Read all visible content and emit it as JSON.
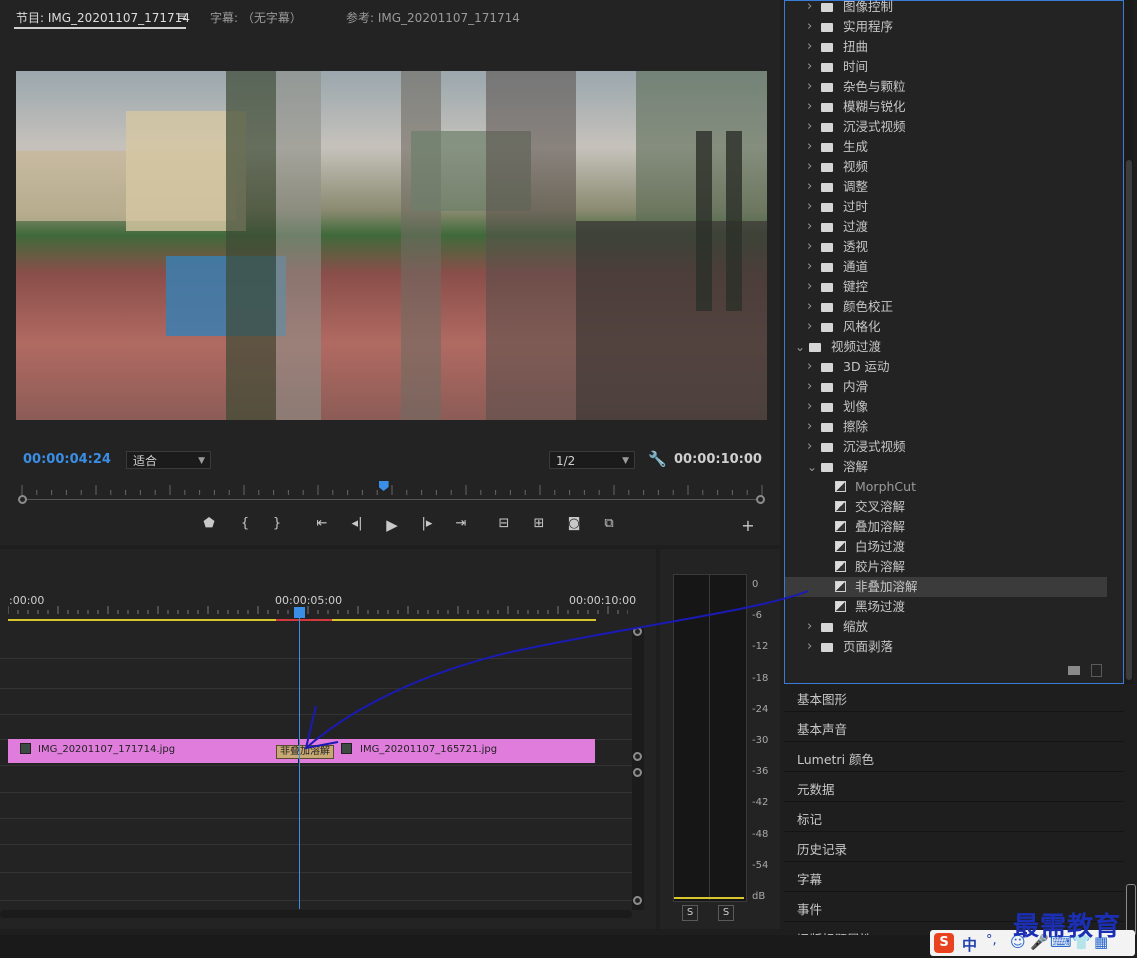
{
  "monitor": {
    "tabs": [
      "节目: IMG_20201107_171714",
      "字幕: （无字幕）",
      "参考: IMG_20201107_171714"
    ],
    "menu_glyph": "≡",
    "current_time": "00:00:04:24",
    "duration": "00:00:10:00",
    "fit_value": "适合",
    "resolution_value": "1/2",
    "playhead_fraction": 0.49
  },
  "timeline": {
    "ticks": [
      ":00:00",
      "00:00:05:00",
      "00:00:10:00"
    ],
    "clips": [
      "IMG_20201107_171714.jpg",
      "IMG_20201107_165721.jpg"
    ],
    "transition_label": "非叠加溶解"
  },
  "meter": {
    "scale": [
      "0",
      "-6",
      "-12",
      "-18",
      "-24",
      "-30",
      "-36",
      "-42",
      "-48",
      "-54",
      "dB"
    ],
    "solo_labels": [
      "S",
      "S"
    ]
  },
  "effects": {
    "rows": [
      {
        "label": "图像控制",
        "level": 1,
        "kind": "folder",
        "open": false
      },
      {
        "label": "实用程序",
        "level": 1,
        "kind": "folder",
        "open": false
      },
      {
        "label": "扭曲",
        "level": 1,
        "kind": "folder",
        "open": false
      },
      {
        "label": "时间",
        "level": 1,
        "kind": "folder",
        "open": false
      },
      {
        "label": "杂色与颗粒",
        "level": 1,
        "kind": "folder",
        "open": false
      },
      {
        "label": "模糊与锐化",
        "level": 1,
        "kind": "folder",
        "open": false
      },
      {
        "label": "沉浸式视频",
        "level": 1,
        "kind": "folder",
        "open": false
      },
      {
        "label": "生成",
        "level": 1,
        "kind": "folder",
        "open": false
      },
      {
        "label": "视频",
        "level": 1,
        "kind": "folder",
        "open": false
      },
      {
        "label": "调整",
        "level": 1,
        "kind": "folder",
        "open": false
      },
      {
        "label": "过时",
        "level": 1,
        "kind": "folder",
        "open": false
      },
      {
        "label": "过渡",
        "level": 1,
        "kind": "folder",
        "open": false
      },
      {
        "label": "透视",
        "level": 1,
        "kind": "folder",
        "open": false
      },
      {
        "label": "通道",
        "level": 1,
        "kind": "folder",
        "open": false
      },
      {
        "label": "键控",
        "level": 1,
        "kind": "folder",
        "open": false
      },
      {
        "label": "颜色校正",
        "level": 1,
        "kind": "folder",
        "open": false
      },
      {
        "label": "风格化",
        "level": 1,
        "kind": "folder",
        "open": false
      },
      {
        "label": "视频过渡",
        "level": 0,
        "kind": "folder",
        "open": true
      },
      {
        "label": "3D 运动",
        "level": 1,
        "kind": "folder",
        "open": false
      },
      {
        "label": "内滑",
        "level": 1,
        "kind": "folder",
        "open": false
      },
      {
        "label": "划像",
        "level": 1,
        "kind": "folder",
        "open": false
      },
      {
        "label": "擦除",
        "level": 1,
        "kind": "folder",
        "open": false
      },
      {
        "label": "沉浸式视频",
        "level": 1,
        "kind": "folder",
        "open": false
      },
      {
        "label": "溶解",
        "level": 1,
        "kind": "folder",
        "open": true
      },
      {
        "label": "MorphCut",
        "level": 2,
        "kind": "effect",
        "open": false
      },
      {
        "label": "交叉溶解",
        "level": 2,
        "kind": "effect",
        "open": false
      },
      {
        "label": "叠加溶解",
        "level": 2,
        "kind": "effect",
        "open": false
      },
      {
        "label": "白场过渡",
        "level": 2,
        "kind": "effect",
        "open": false
      },
      {
        "label": "胶片溶解",
        "level": 2,
        "kind": "effect",
        "open": false
      },
      {
        "label": "非叠加溶解",
        "level": 2,
        "kind": "effect",
        "open": false,
        "selected": true
      },
      {
        "label": "黑场过渡",
        "level": 2,
        "kind": "effect",
        "open": false
      },
      {
        "label": "缩放",
        "level": 1,
        "kind": "folder",
        "open": false
      },
      {
        "label": "页面剥落",
        "level": 1,
        "kind": "folder",
        "open": false
      }
    ]
  },
  "panels": [
    "基本图形",
    "基本声音",
    "Lumetri 颜色",
    "元数据",
    "标记",
    "历史记录",
    "字幕",
    "事件",
    "旧版标题属性"
  ],
  "watermark": "最需教育",
  "ime": {
    "logo": "S",
    "mode": "中",
    "punct": "°,"
  }
}
